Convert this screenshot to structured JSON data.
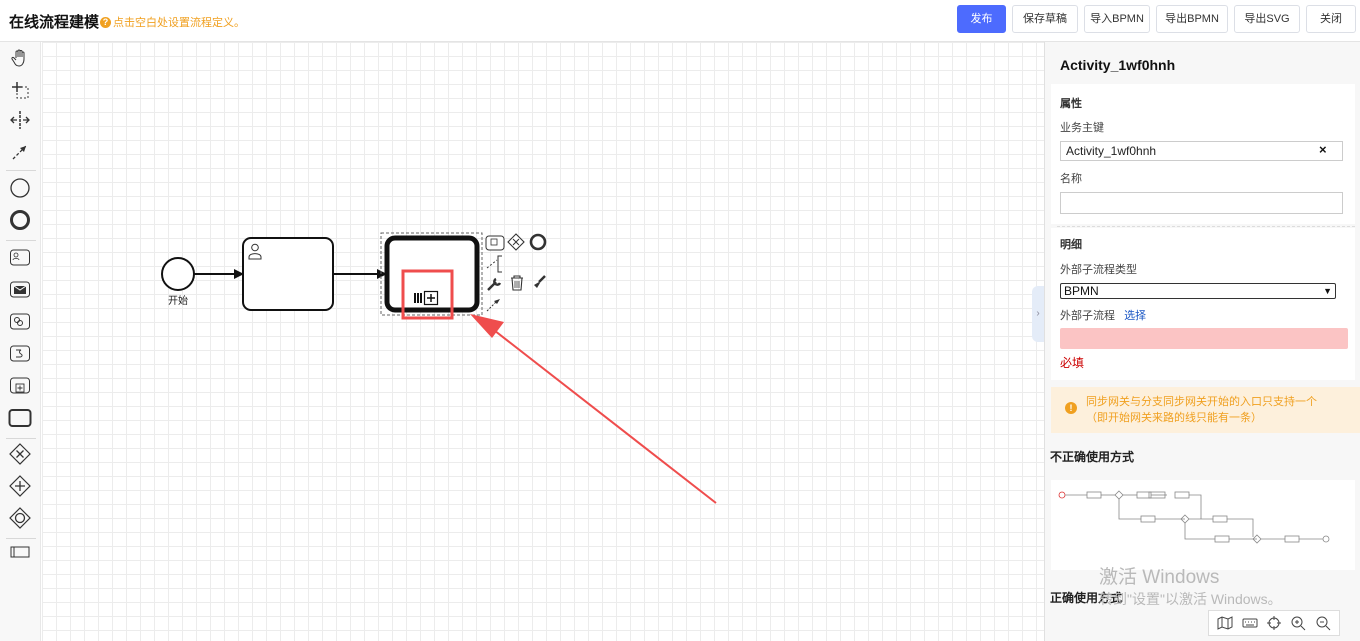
{
  "header": {
    "title": "在线流程建模",
    "hint": "点击空白处设置流程定义。",
    "buttons": {
      "publish": "发布",
      "save_draft": "保存草稿",
      "import_bpmn": "导入BPMN",
      "export_bpmn": "导出BPMN",
      "export_svg": "导出SVG",
      "close": "关闭"
    },
    "accent_color": "#4d6bfe"
  },
  "palette": {
    "tools": [
      "hand-tool-icon",
      "lasso-tool-icon",
      "space-tool-icon",
      "connect-tool-icon",
      "start-event-icon",
      "end-event-icon",
      "user-task-icon",
      "receive-task-icon",
      "service-task-icon",
      "script-task-icon",
      "subprocess-icon",
      "task-icon",
      "exclusive-gateway-icon",
      "parallel-gateway-icon",
      "inclusive-gateway-icon",
      "pool-icon"
    ]
  },
  "diagram": {
    "start_event_label": "开始"
  },
  "panel": {
    "element_id": "Activity_1wf0hnh",
    "section_properties": "属性",
    "business_key_label": "业务主键",
    "business_key_value": "Activity_1wf0hnh",
    "clear_symbol": "×",
    "name_label": "名称",
    "name_value": "",
    "section_detail": "明细",
    "subprocess_type_label": "外部子流程类型",
    "subprocess_type_value": "BPMN",
    "subprocess_label": "外部子流程",
    "select_link": "选择",
    "required_text": "必填",
    "warning_text": "同步网关与分支同步网关开始的入口只支持一个（即开始网关来路的线只能有一条）",
    "wrong_usage_title": "不正确使用方式",
    "correct_usage_title": "正确使用方式",
    "error_color": "#fbc4c4",
    "warning_color": "#f0a020"
  },
  "watermark": {
    "line1": "激活 Windows",
    "line2": "转到\"设置\"以激活 Windows。"
  },
  "zoom_controls": [
    "map-icon",
    "keyboard-icon",
    "crosshair-icon",
    "zoom-in-icon",
    "zoom-out-icon"
  ]
}
